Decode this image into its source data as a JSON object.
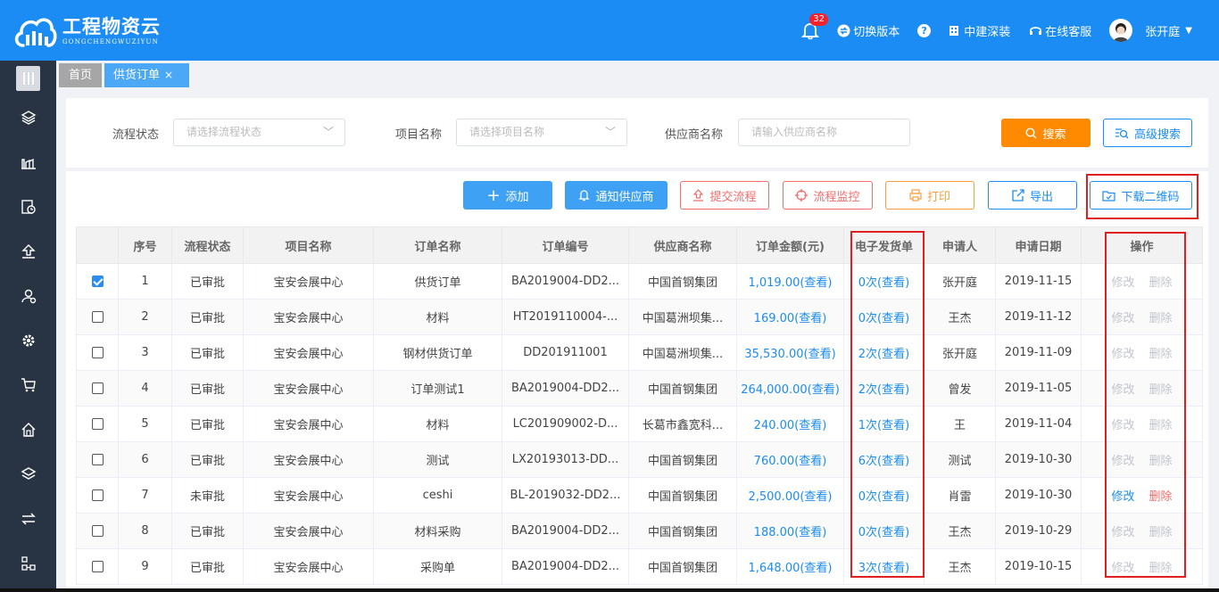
{
  "header": {
    "logo_cn": "工程物资云",
    "logo_en": "GONGCHENGWUZIYUN",
    "notification_count": "32",
    "switch_version": "切换版本",
    "company": "中建深装",
    "service": "在线客服",
    "user_name": "张开庭",
    "help": "?"
  },
  "tabs": [
    {
      "label": "首页"
    },
    {
      "label": "供货订单",
      "close": "×"
    }
  ],
  "filters": {
    "status_label": "流程状态",
    "status_placeholder": "请选择流程状态",
    "project_label": "项目名称",
    "project_placeholder": "请选择项目名称",
    "supplier_label": "供应商名称",
    "supplier_placeholder": "请输入供应商名称",
    "search_button": "搜索",
    "advanced_button": "高级搜索"
  },
  "toolbar": {
    "add": "添加",
    "notify": "通知供应商",
    "submit": "提交流程",
    "monitor": "流程监控",
    "print": "打印",
    "export": "导出",
    "qrcode": "下载二维码"
  },
  "table": {
    "headers": [
      "",
      "序号",
      "流程状态",
      "项目名称",
      "订单名称",
      "订单编号",
      "供应商名称",
      "订单金额(元)",
      "电子发货单",
      "申请人",
      "申请日期",
      "操作"
    ],
    "edit_label": "修改",
    "delete_label": "删除",
    "rows": [
      {
        "checked": true,
        "no": "1",
        "status": "已审批",
        "project": "宝安会展中心",
        "name": "供货订单",
        "code": "BA2019004-DD2...",
        "supplier": "中国首钢集团",
        "amount": "1,019.00(查看)",
        "delivery": "0次(查看)",
        "applicant": "张开庭",
        "date": "2019-11-15",
        "actions_enabled": false
      },
      {
        "checked": false,
        "no": "2",
        "status": "已审批",
        "project": "宝安会展中心",
        "name": "材料",
        "code": "HT2019110004-...",
        "supplier": "中国葛洲坝集...",
        "amount": "169.00(查看)",
        "delivery": "0次(查看)",
        "applicant": "王杰",
        "date": "2019-11-12",
        "actions_enabled": false
      },
      {
        "checked": false,
        "no": "3",
        "status": "已审批",
        "project": "宝安会展中心",
        "name": "钢材供货订单",
        "code": "DD201911001",
        "supplier": "中国葛洲坝集...",
        "amount": "35,530.00(查看)",
        "delivery": "2次(查看)",
        "applicant": "张开庭",
        "date": "2019-11-09",
        "actions_enabled": false
      },
      {
        "checked": false,
        "no": "4",
        "status": "已审批",
        "project": "宝安会展中心",
        "name": "订单测试1",
        "code": "BA2019004-DD2...",
        "supplier": "中国首钢集团",
        "amount": "264,000.00(查看)",
        "delivery": "2次(查看)",
        "applicant": "曾发",
        "date": "2019-11-05",
        "actions_enabled": false
      },
      {
        "checked": false,
        "no": "5",
        "status": "已审批",
        "project": "宝安会展中心",
        "name": "材料",
        "code": "LC201909002-D...",
        "supplier": "长葛市鑫宽科...",
        "amount": "240.00(查看)",
        "delivery": "1次(查看)",
        "applicant": "王",
        "date": "2019-11-04",
        "actions_enabled": false
      },
      {
        "checked": false,
        "no": "6",
        "status": "已审批",
        "project": "宝安会展中心",
        "name": "测试",
        "code": "LX20193013-DD...",
        "supplier": "中国首钢集团",
        "amount": "760.00(查看)",
        "delivery": "6次(查看)",
        "applicant": "测试",
        "date": "2019-10-30",
        "actions_enabled": false
      },
      {
        "checked": false,
        "no": "7",
        "status": "未审批",
        "project": "宝安会展中心",
        "name": "ceshi",
        "code": "BL-2019032-DD2...",
        "supplier": "中国首钢集团",
        "amount": "2,500.00(查看)",
        "delivery": "0次(查看)",
        "applicant": "肖雷",
        "date": "2019-10-30",
        "actions_enabled": true
      },
      {
        "checked": false,
        "no": "8",
        "status": "已审批",
        "project": "宝安会展中心",
        "name": "材料采购",
        "code": "BA2019004-DD2...",
        "supplier": "中国首钢集团",
        "amount": "188.00(查看)",
        "delivery": "0次(查看)",
        "applicant": "王杰",
        "date": "2019-10-29",
        "actions_enabled": false
      },
      {
        "checked": false,
        "no": "9",
        "status": "已审批",
        "project": "宝安会展中心",
        "name": "采购单",
        "code": "BA2019004-DD2...",
        "supplier": "中国首钢集团",
        "amount": "1,648.00(查看)",
        "delivery": "3次(查看)",
        "applicant": "王杰",
        "date": "2019-10-15",
        "actions_enabled": false
      }
    ]
  },
  "colors": {
    "header_bg": "#1a8cf3",
    "sidebar_bg": "#283443",
    "highlight": "#e02020",
    "link": "#1a8cf3"
  }
}
